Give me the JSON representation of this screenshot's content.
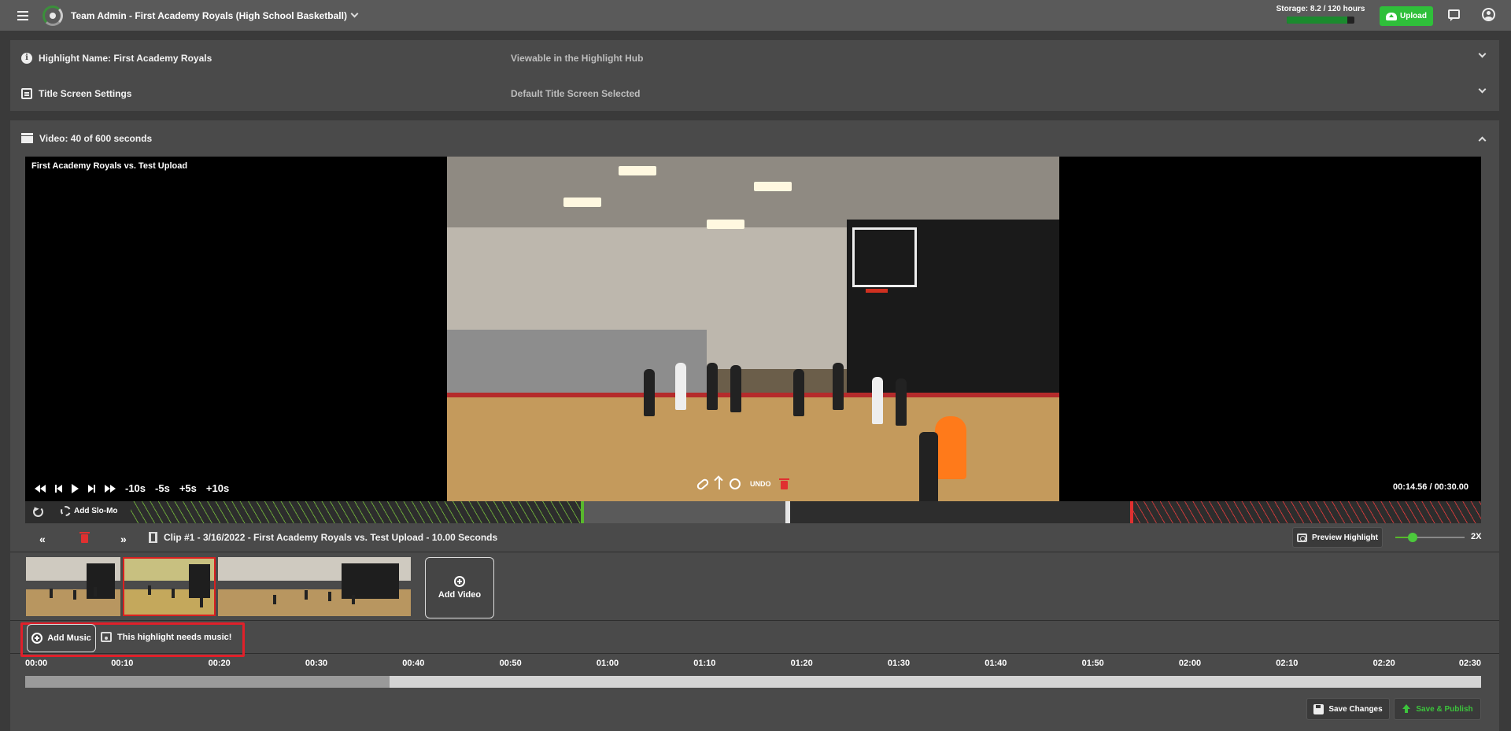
{
  "topbar": {
    "team_name": "Team Admin - First Academy Royals (High School Basketball)",
    "storage_label": "Storage: 8.2 / 120 hours",
    "storage_used_fraction": 0.9,
    "upload_label": "Upload"
  },
  "highlight_row": {
    "title": "Highlight Name: First Academy Royals",
    "subtitle": "Viewable in the Highlight Hub"
  },
  "title_screen_row": {
    "title": "Title Screen Settings",
    "subtitle": "Default Title Screen Selected"
  },
  "video_section": {
    "title": "Video: 40 of 600 seconds",
    "video_title": "First Academy Royals vs. Test Upload",
    "time_readout": "00:14.56 / 00:30.00",
    "skip_labels": [
      "-10s",
      "-5s",
      "+5s",
      "+10s"
    ],
    "undo_label": "UNDO",
    "slomo_label": "Add Slo-Mo"
  },
  "clip": {
    "title": "Clip #1 - 3/16/2022 - First Academy Royals vs. Test Upload - 10.00 Seconds",
    "preview_label": "Preview Highlight",
    "speed_label": "2X",
    "speed_fraction": 0.25,
    "add_video_label": "Add Video"
  },
  "music": {
    "add_music_label": "Add Music",
    "notice": "This highlight needs music!"
  },
  "timeline": {
    "ticks": [
      "00:00",
      "00:10",
      "00:20",
      "00:30",
      "00:40",
      "00:50",
      "01:00",
      "01:10",
      "01:20",
      "01:30",
      "01:40",
      "01:50",
      "02:00",
      "02:10",
      "02:20",
      "02:30"
    ],
    "progress_fraction": 0.25
  },
  "actions": {
    "save_label": "Save Changes",
    "publish_label": "Save & Publish"
  },
  "colors": {
    "accent_green": "#2fbf3a",
    "highlight_red": "#e0202a"
  }
}
